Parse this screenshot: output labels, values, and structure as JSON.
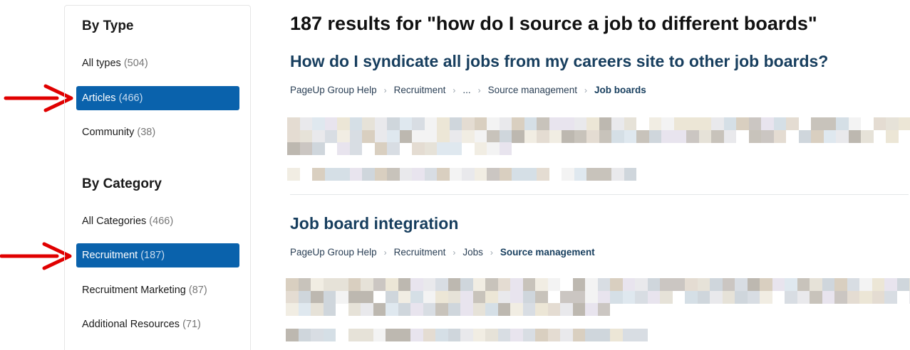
{
  "sidebar": {
    "by_type": {
      "title": "By Type",
      "items": [
        {
          "label": "All types",
          "count": "(504)",
          "active": false
        },
        {
          "label": "Articles",
          "count": "(466)",
          "active": true
        },
        {
          "label": "Community",
          "count": "(38)",
          "active": false
        }
      ]
    },
    "by_category": {
      "title": "By Category",
      "items": [
        {
          "label": "All Categories",
          "count": "(466)",
          "active": false
        },
        {
          "label": "Recruitment",
          "count": "(187)",
          "active": true
        },
        {
          "label": "Recruitment Marketing",
          "count": "(87)",
          "active": false
        },
        {
          "label": "Additional Resources",
          "count": "(71)",
          "active": false
        }
      ]
    }
  },
  "main": {
    "heading": "187 results for \"how do I source a job to different boards\"",
    "results": [
      {
        "title": "How do I syndicate all jobs from my careers site to other job boards?",
        "breadcrumb": [
          "PageUp Group Help",
          "Recruitment",
          "...",
          "Source management",
          "Job boards"
        ]
      },
      {
        "title": "Job board integration",
        "breadcrumb": [
          "PageUp Group Help",
          "Recruitment",
          "Jobs",
          "Source management"
        ]
      }
    ]
  },
  "colors": {
    "active_facet": "#0a62ac",
    "title_link": "#173e5e",
    "arrow": "#e00000"
  }
}
